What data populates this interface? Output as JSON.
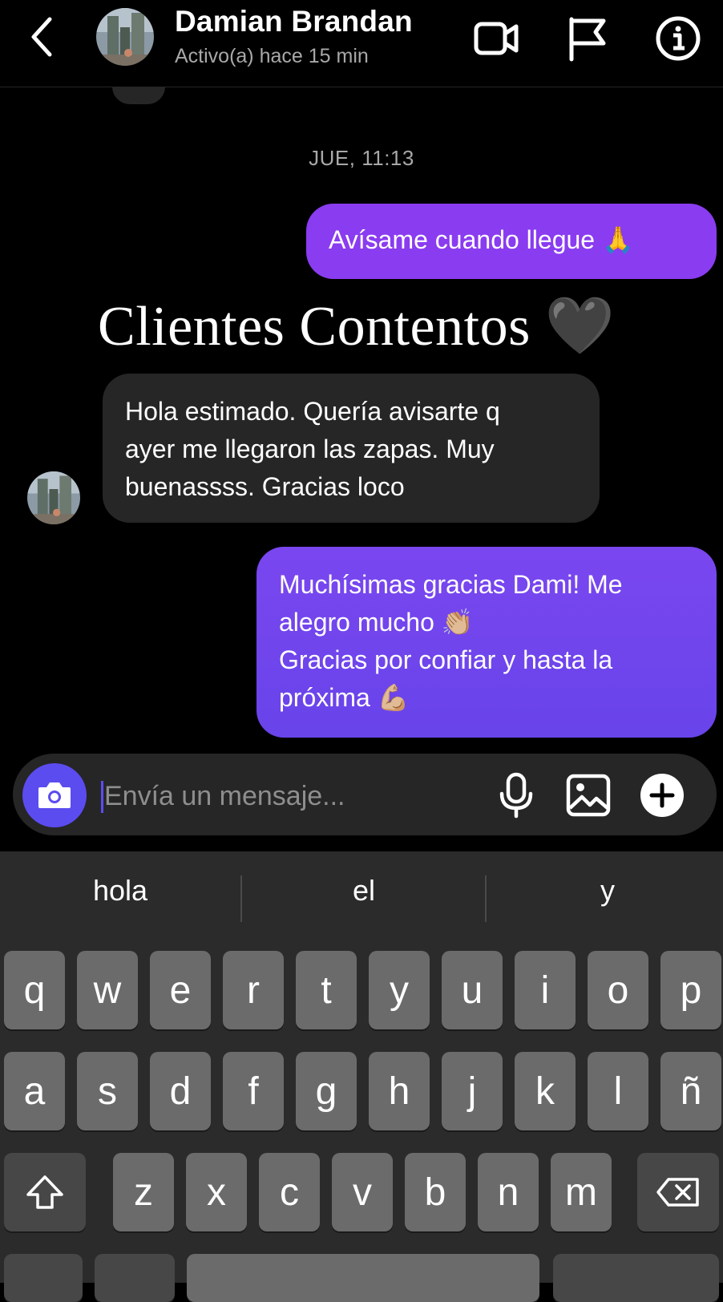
{
  "header": {
    "name": "Damian Brandan",
    "status": "Activo(a) hace 15 min"
  },
  "thread": {
    "timestamp": "JUE, 11:13",
    "messages": [
      {
        "from": "me",
        "text": "Avísame cuando llegue 🙏"
      },
      {
        "from": "contact",
        "lines": [
          "Hola estimado. Quería avisarte q",
          "ayer me llegaron las zapas. Muy",
          "buenassss. Gracias loco"
        ]
      },
      {
        "from": "me",
        "lines": [
          "Muchísimas gracias Dami! Me",
          "alegro mucho 👏🏼",
          "Gracias por confiar y hasta la",
          "próxima 💪🏼"
        ]
      }
    ]
  },
  "overlay_text": "Clientes Contentos 🖤",
  "composer": {
    "placeholder": "Envía un mensaje..."
  },
  "keyboard": {
    "suggestions": [
      "hola",
      "el",
      "y"
    ],
    "row1": [
      "q",
      "w",
      "e",
      "r",
      "t",
      "y",
      "u",
      "i",
      "o",
      "p"
    ],
    "row2": [
      "a",
      "s",
      "d",
      "f",
      "g",
      "h",
      "j",
      "k",
      "l",
      "ñ"
    ],
    "row3": [
      "z",
      "x",
      "c",
      "v",
      "b",
      "n",
      "m"
    ]
  },
  "colors": {
    "background": "#000000",
    "sent_bubble_top": "#8a3cf0",
    "sent_bubble_bottom": "#6844ea",
    "received_bubble": "#262626",
    "accent": "#5b4cf0",
    "keyboard_bg": "#2b2b2b",
    "key_bg": "#6b6b6b"
  },
  "icons": [
    "back-icon",
    "video-call-icon",
    "flag-icon",
    "info-icon",
    "camera-icon",
    "microphone-icon",
    "gallery-icon",
    "plus-icon",
    "shift-icon",
    "backspace-icon"
  ]
}
